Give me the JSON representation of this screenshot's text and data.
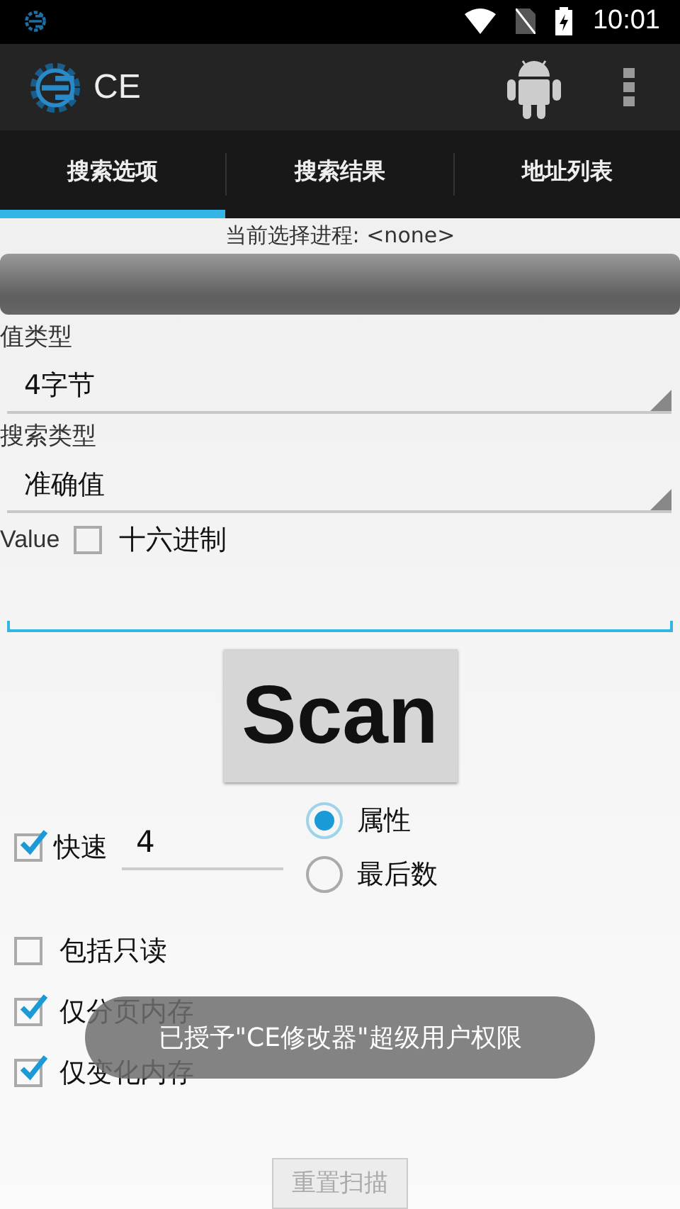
{
  "status_bar": {
    "time": "10:01"
  },
  "app_bar": {
    "title": "CE"
  },
  "tabs": [
    {
      "label": "搜索选项",
      "selected": true
    },
    {
      "label": "搜索结果",
      "selected": false
    },
    {
      "label": "地址列表",
      "selected": false
    }
  ],
  "process": {
    "label": "当前选择进程: <none>"
  },
  "value_type": {
    "label": "值类型",
    "value": "4字节"
  },
  "scan_type": {
    "label": "搜索类型",
    "value": "准确值"
  },
  "value": {
    "label": "Value",
    "hex": {
      "label": "十六进制",
      "checked": false
    }
  },
  "scan_button": {
    "label": "Scan"
  },
  "fast": {
    "label": "快速",
    "checked": true,
    "value": "4"
  },
  "radios": [
    {
      "label": "属性",
      "selected": true
    },
    {
      "label": "最后数",
      "selected": false
    }
  ],
  "options": [
    {
      "label": "包括只读",
      "checked": false
    },
    {
      "label": "仅分页内存",
      "checked": true
    },
    {
      "label": "仅变化内存",
      "checked": true
    }
  ],
  "reset_button": {
    "label": "重置扫描",
    "disabled": true
  },
  "toast": {
    "text": "已授予\"CE修改器\"超级用户权限"
  }
}
